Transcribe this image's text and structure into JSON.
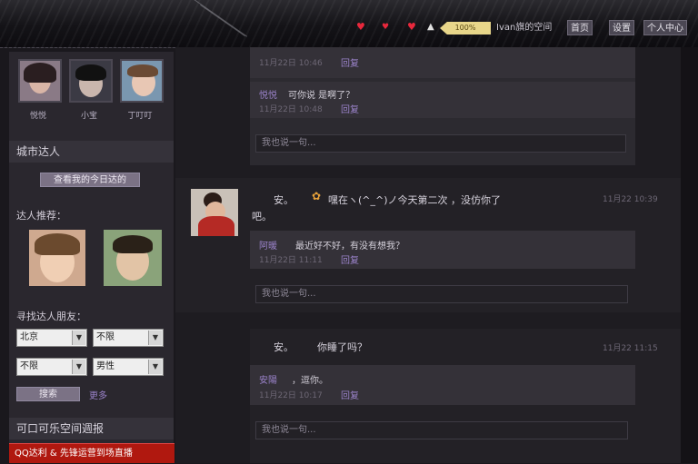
{
  "topbar": {
    "badge_text": "100%",
    "nav": [
      {
        "label": "Ivan旗的空间"
      },
      {
        "label": "首页"
      },
      {
        "label": "设置"
      },
      {
        "label": "个人中心"
      }
    ]
  },
  "sidebar": {
    "friends": [
      {
        "name": "悦悦"
      },
      {
        "name": "小宝"
      },
      {
        "name": "丁叮叮"
      }
    ],
    "section_experts": "城市达人",
    "expert_button": "查看我的今日达的",
    "recommend_label": "达人推荐：",
    "find_label": "寻找达人朋友：",
    "selects": [
      {
        "value": "北京"
      },
      {
        "value": "不限"
      },
      {
        "value": "不限"
      },
      {
        "value": "男性"
      }
    ],
    "search_button": "搜索",
    "search_more": "更多",
    "bottom_section": "可口可乐空间週报",
    "red_banner": "QQ达利 & 先锋运营到场直播"
  },
  "feed": {
    "reply_placeholder": "我也说一句...",
    "reply_action": "回复",
    "block1": {
      "reply1_time": "11月22日 10:46",
      "reply2_name": "悦悦",
      "reply2_text": "可你说  是啊了？",
      "reply2_time": "11月22日 10:48"
    },
    "post1": {
      "author": "安。",
      "text1": "嘿在ヽ(^_^)ノ今天第二次 ，没仿你了",
      "text2": "吧。",
      "time": "11月22 10:39",
      "reply_name": "阿暖",
      "reply_text": "最近好不好，有没有想我？",
      "reply_time": "11月22日 11:11"
    },
    "post2": {
      "author": "安。",
      "text": "你睡了吗？",
      "time": "11月22 11:15",
      "reply_name": "安陽",
      "reply_text": "，逗你。",
      "reply_time": "11月22日 10:17"
    }
  },
  "colors": {
    "accent": "#9a82c9",
    "banner": "#b0180f",
    "badge": "#e8d68a"
  }
}
